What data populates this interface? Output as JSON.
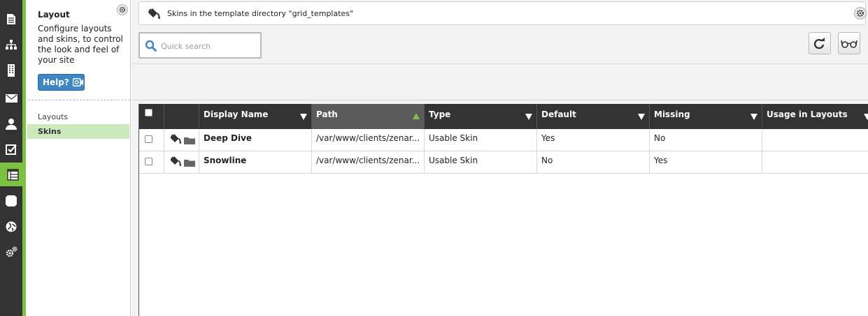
{
  "sidebar_rail": {
    "items": [
      {
        "icon": "document-icon"
      },
      {
        "icon": "sitemap-icon"
      },
      {
        "icon": "building-icon"
      },
      {
        "icon": "envelope-icon"
      },
      {
        "icon": "user-icon"
      },
      {
        "icon": "checkbox-icon"
      },
      {
        "icon": "layout-icon",
        "active": true
      },
      {
        "icon": "puzzle-icon"
      },
      {
        "icon": "globe-icon"
      },
      {
        "icon": "gears-icon"
      }
    ],
    "accent_color": "#7cc142"
  },
  "info_panel": {
    "title": "Layout",
    "description": "Configure layouts and skins, to control the look and feel of your site",
    "help_label": "Help?",
    "nav_items": [
      {
        "label": "Layouts",
        "active": false
      },
      {
        "label": "Skins",
        "active": true
      }
    ]
  },
  "breadcrumb": {
    "text": "Skins in the template directory \"grid_templates\""
  },
  "search": {
    "placeholder": "Quick search",
    "value": ""
  },
  "toolbar": {
    "refresh_icon": "refresh-icon",
    "view_icon": "glasses-icon"
  },
  "table": {
    "columns": [
      {
        "label": "",
        "type": "checkbox"
      },
      {
        "label": "",
        "type": "icons"
      },
      {
        "label": "Display Name",
        "sort": "none"
      },
      {
        "label": "Path",
        "sort": "asc"
      },
      {
        "label": "Type",
        "sort": "none"
      },
      {
        "label": "Default",
        "sort": "none"
      },
      {
        "label": "Missing",
        "sort": "none"
      },
      {
        "label": "Usage in Layouts",
        "sort": "none"
      }
    ],
    "rows": [
      {
        "display_name": "Deep Dive",
        "path": "/var/www/clients/zenar...",
        "type": "Usable Skin",
        "default": "Yes",
        "missing": "No",
        "usage": ""
      },
      {
        "display_name": "Snowline",
        "path": "/var/www/clients/zenar...",
        "type": "Usable Skin",
        "default": "No",
        "missing": "Yes",
        "usage": ""
      }
    ]
  },
  "colors": {
    "header_bg": "#333333",
    "sorted_header_bg": "#5b5b5b",
    "sort_arrow": "#7cc142",
    "help_button": "#3f86c2",
    "active_nav": "#cce8bd"
  }
}
